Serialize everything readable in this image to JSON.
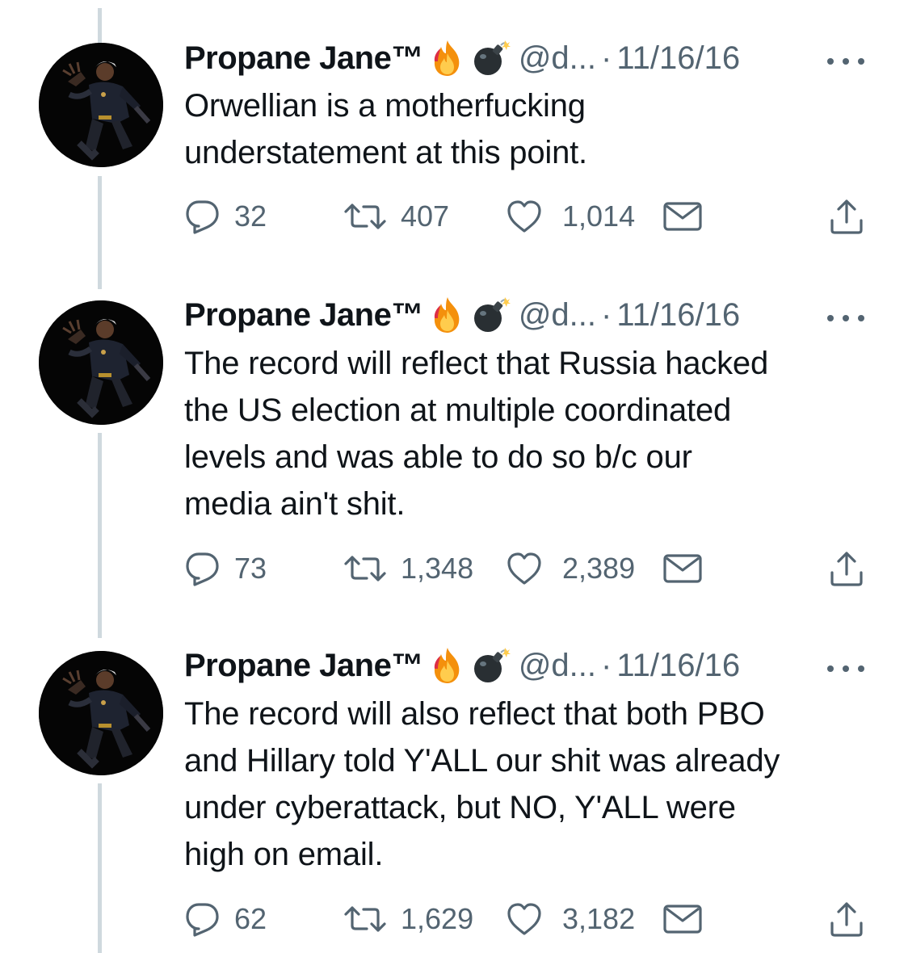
{
  "tweets": [
    {
      "display_name": "Propane Jane™",
      "badges": [
        "fire-emoji",
        "bomb-emoji"
      ],
      "handle": "@d...",
      "separator": "·",
      "date": "11/16/16",
      "text": "Orwellian is a motherfucking\nunderstatement at this point.",
      "replies": "32",
      "retweets": "407",
      "likes": "1,014"
    },
    {
      "display_name": "Propane Jane™",
      "badges": [
        "fire-emoji",
        "bomb-emoji"
      ],
      "handle": "@d...",
      "separator": "·",
      "date": "11/16/16",
      "text": "The record will reflect that Russia hacked\nthe US election at multiple coordinated\nlevels and was able to do so b/c our\nmedia ain't shit.",
      "replies": "73",
      "retweets": "1,348",
      "likes": "2,389"
    },
    {
      "display_name": "Propane Jane™",
      "badges": [
        "fire-emoji",
        "bomb-emoji"
      ],
      "handle": "@d...",
      "separator": "·",
      "date": "11/16/16",
      "text": "The record will also reflect that both PBO\nand Hillary told Y'ALL our shit was already\nunder cyberattack, but NO, Y'ALL were\nhigh on email.",
      "replies": "62",
      "retweets": "1,629",
      "likes": "3,182"
    }
  ],
  "icons": {
    "reply": "reply-icon",
    "retweet": "retweet-icon",
    "like": "heart-icon",
    "message": "envelope-icon",
    "share": "share-icon",
    "more": "more-dots-icon"
  },
  "colors": {
    "text": "#0f1419",
    "secondary": "#536471",
    "thread_line": "#cfd9de",
    "background": "#ffffff"
  }
}
